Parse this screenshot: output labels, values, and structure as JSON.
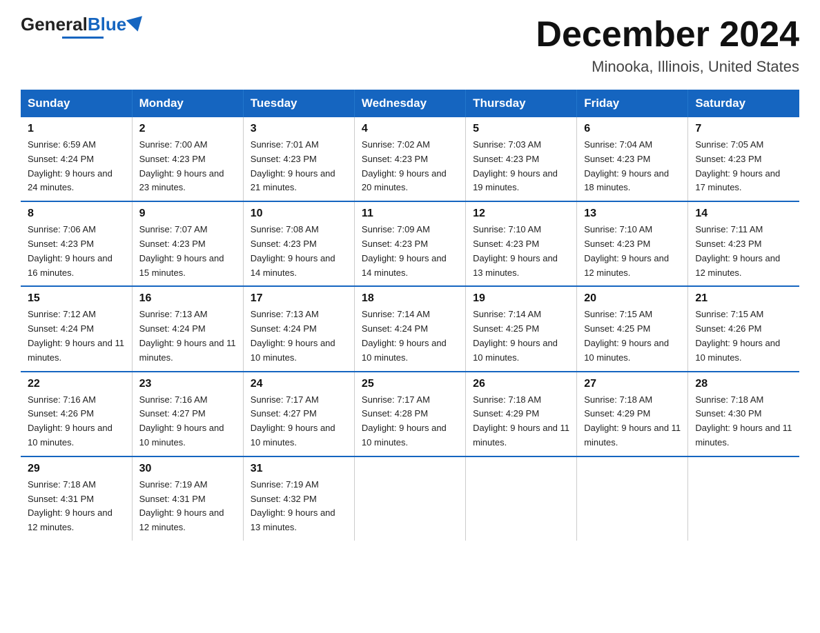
{
  "logo": {
    "general": "General",
    "blue": "Blue"
  },
  "title": "December 2024",
  "location": "Minooka, Illinois, United States",
  "days_of_week": [
    "Sunday",
    "Monday",
    "Tuesday",
    "Wednesday",
    "Thursday",
    "Friday",
    "Saturday"
  ],
  "weeks": [
    [
      {
        "day": "1",
        "sunrise": "6:59 AM",
        "sunset": "4:24 PM",
        "daylight": "9 hours and 24 minutes."
      },
      {
        "day": "2",
        "sunrise": "7:00 AM",
        "sunset": "4:23 PM",
        "daylight": "9 hours and 23 minutes."
      },
      {
        "day": "3",
        "sunrise": "7:01 AM",
        "sunset": "4:23 PM",
        "daylight": "9 hours and 21 minutes."
      },
      {
        "day": "4",
        "sunrise": "7:02 AM",
        "sunset": "4:23 PM",
        "daylight": "9 hours and 20 minutes."
      },
      {
        "day": "5",
        "sunrise": "7:03 AM",
        "sunset": "4:23 PM",
        "daylight": "9 hours and 19 minutes."
      },
      {
        "day": "6",
        "sunrise": "7:04 AM",
        "sunset": "4:23 PM",
        "daylight": "9 hours and 18 minutes."
      },
      {
        "day": "7",
        "sunrise": "7:05 AM",
        "sunset": "4:23 PM",
        "daylight": "9 hours and 17 minutes."
      }
    ],
    [
      {
        "day": "8",
        "sunrise": "7:06 AM",
        "sunset": "4:23 PM",
        "daylight": "9 hours and 16 minutes."
      },
      {
        "day": "9",
        "sunrise": "7:07 AM",
        "sunset": "4:23 PM",
        "daylight": "9 hours and 15 minutes."
      },
      {
        "day": "10",
        "sunrise": "7:08 AM",
        "sunset": "4:23 PM",
        "daylight": "9 hours and 14 minutes."
      },
      {
        "day": "11",
        "sunrise": "7:09 AM",
        "sunset": "4:23 PM",
        "daylight": "9 hours and 14 minutes."
      },
      {
        "day": "12",
        "sunrise": "7:10 AM",
        "sunset": "4:23 PM",
        "daylight": "9 hours and 13 minutes."
      },
      {
        "day": "13",
        "sunrise": "7:10 AM",
        "sunset": "4:23 PM",
        "daylight": "9 hours and 12 minutes."
      },
      {
        "day": "14",
        "sunrise": "7:11 AM",
        "sunset": "4:23 PM",
        "daylight": "9 hours and 12 minutes."
      }
    ],
    [
      {
        "day": "15",
        "sunrise": "7:12 AM",
        "sunset": "4:24 PM",
        "daylight": "9 hours and 11 minutes."
      },
      {
        "day": "16",
        "sunrise": "7:13 AM",
        "sunset": "4:24 PM",
        "daylight": "9 hours and 11 minutes."
      },
      {
        "day": "17",
        "sunrise": "7:13 AM",
        "sunset": "4:24 PM",
        "daylight": "9 hours and 10 minutes."
      },
      {
        "day": "18",
        "sunrise": "7:14 AM",
        "sunset": "4:24 PM",
        "daylight": "9 hours and 10 minutes."
      },
      {
        "day": "19",
        "sunrise": "7:14 AM",
        "sunset": "4:25 PM",
        "daylight": "9 hours and 10 minutes."
      },
      {
        "day": "20",
        "sunrise": "7:15 AM",
        "sunset": "4:25 PM",
        "daylight": "9 hours and 10 minutes."
      },
      {
        "day": "21",
        "sunrise": "7:15 AM",
        "sunset": "4:26 PM",
        "daylight": "9 hours and 10 minutes."
      }
    ],
    [
      {
        "day": "22",
        "sunrise": "7:16 AM",
        "sunset": "4:26 PM",
        "daylight": "9 hours and 10 minutes."
      },
      {
        "day": "23",
        "sunrise": "7:16 AM",
        "sunset": "4:27 PM",
        "daylight": "9 hours and 10 minutes."
      },
      {
        "day": "24",
        "sunrise": "7:17 AM",
        "sunset": "4:27 PM",
        "daylight": "9 hours and 10 minutes."
      },
      {
        "day": "25",
        "sunrise": "7:17 AM",
        "sunset": "4:28 PM",
        "daylight": "9 hours and 10 minutes."
      },
      {
        "day": "26",
        "sunrise": "7:18 AM",
        "sunset": "4:29 PM",
        "daylight": "9 hours and 11 minutes."
      },
      {
        "day": "27",
        "sunrise": "7:18 AM",
        "sunset": "4:29 PM",
        "daylight": "9 hours and 11 minutes."
      },
      {
        "day": "28",
        "sunrise": "7:18 AM",
        "sunset": "4:30 PM",
        "daylight": "9 hours and 11 minutes."
      }
    ],
    [
      {
        "day": "29",
        "sunrise": "7:18 AM",
        "sunset": "4:31 PM",
        "daylight": "9 hours and 12 minutes."
      },
      {
        "day": "30",
        "sunrise": "7:19 AM",
        "sunset": "4:31 PM",
        "daylight": "9 hours and 12 minutes."
      },
      {
        "day": "31",
        "sunrise": "7:19 AM",
        "sunset": "4:32 PM",
        "daylight": "9 hours and 13 minutes."
      },
      null,
      null,
      null,
      null
    ]
  ],
  "labels": {
    "sunrise_prefix": "Sunrise: ",
    "sunset_prefix": "Sunset: ",
    "daylight_prefix": "Daylight: "
  }
}
